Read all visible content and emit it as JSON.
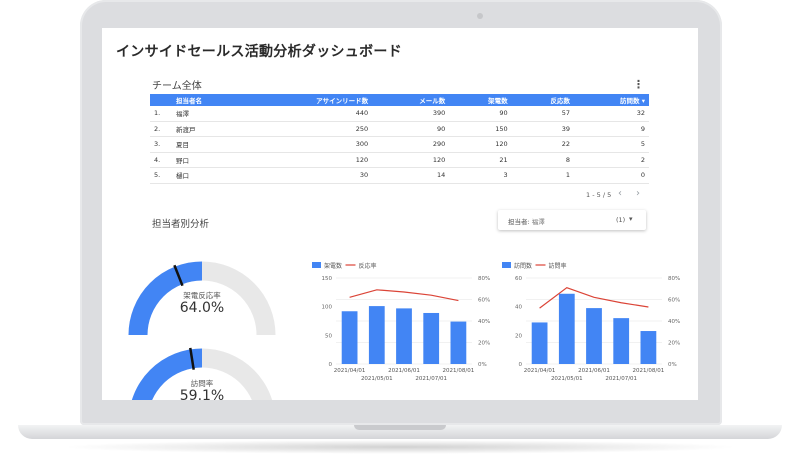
{
  "report": {
    "title": "インサイドセールス活動分析ダッシュボード"
  },
  "team_table": {
    "title": "チーム全体",
    "headers": [
      "担当者名",
      "アサインリード数",
      "メール数",
      "架電数",
      "反応数",
      "訪問数"
    ],
    "sort_indicator": "▾",
    "rows": [
      {
        "idx": "1.",
        "name": "福澤",
        "leads": "440",
        "mail": "390",
        "calls": "90",
        "responses": "57",
        "visits": "32"
      },
      {
        "idx": "2.",
        "name": "新渡戸",
        "leads": "250",
        "mail": "90",
        "calls": "150",
        "responses": "39",
        "visits": "9"
      },
      {
        "idx": "3.",
        "name": "夏目",
        "leads": "300",
        "mail": "290",
        "calls": "120",
        "responses": "22",
        "visits": "5"
      },
      {
        "idx": "4.",
        "name": "野口",
        "leads": "120",
        "mail": "120",
        "calls": "21",
        "responses": "8",
        "visits": "2"
      },
      {
        "idx": "5.",
        "name": "樋口",
        "leads": "30",
        "mail": "14",
        "calls": "3",
        "responses": "1",
        "visits": "0"
      }
    ],
    "pagination": "1 - 5 / 5"
  },
  "person_section": {
    "title": "担当者別分析",
    "filter_label": "担当者:",
    "filter_value": "福澤",
    "filter_count": "(1)"
  },
  "gauges": [
    {
      "label": "架電反応率",
      "value_text": "64.0%",
      "fraction": 0.5,
      "target": 0.38
    },
    {
      "label": "訪問率",
      "value_text": "59.1%",
      "fraction": 0.5,
      "target": 0.45
    }
  ],
  "colors": {
    "accent": "#4285f4",
    "line": "#db4437",
    "track": "#e8e8e8"
  },
  "chart_data": [
    {
      "type": "bar",
      "categories": [
        "2021/04/01",
        "2021/05/01",
        "2021/06/01",
        "2021/07/01",
        "2021/08/01"
      ],
      "series": [
        {
          "name": "架電数",
          "type": "bar",
          "axis": "left",
          "values": [
            92,
            101,
            97,
            89,
            74
          ]
        },
        {
          "name": "反応率",
          "type": "line",
          "axis": "right",
          "values": [
            62,
            69,
            67,
            64,
            59
          ]
        }
      ],
      "left_ticks": [
        "150",
        "100",
        "50",
        "0"
      ],
      "right_ticks": [
        "80%",
        "60%",
        "40%",
        "20%",
        "0%"
      ],
      "ylim_left": [
        0,
        150
      ],
      "ylim_right": [
        0,
        80
      ],
      "legend_position": "top-left"
    },
    {
      "type": "bar",
      "categories": [
        "2021/04/01",
        "2021/05/01",
        "2021/06/01",
        "2021/07/01",
        "2021/08/01"
      ],
      "series": [
        {
          "name": "訪問数",
          "type": "bar",
          "axis": "left",
          "values": [
            29,
            49,
            39,
            32,
            23
          ]
        },
        {
          "name": "訪問率",
          "type": "line",
          "axis": "right",
          "values": [
            52,
            71,
            62,
            57,
            53
          ]
        }
      ],
      "left_ticks": [
        "60",
        "40",
        "20",
        "0"
      ],
      "right_ticks": [
        "80%",
        "60%",
        "40%",
        "20%",
        "0%"
      ],
      "ylim_left": [
        0,
        60
      ],
      "ylim_right": [
        0,
        80
      ],
      "legend_position": "top-left"
    }
  ]
}
